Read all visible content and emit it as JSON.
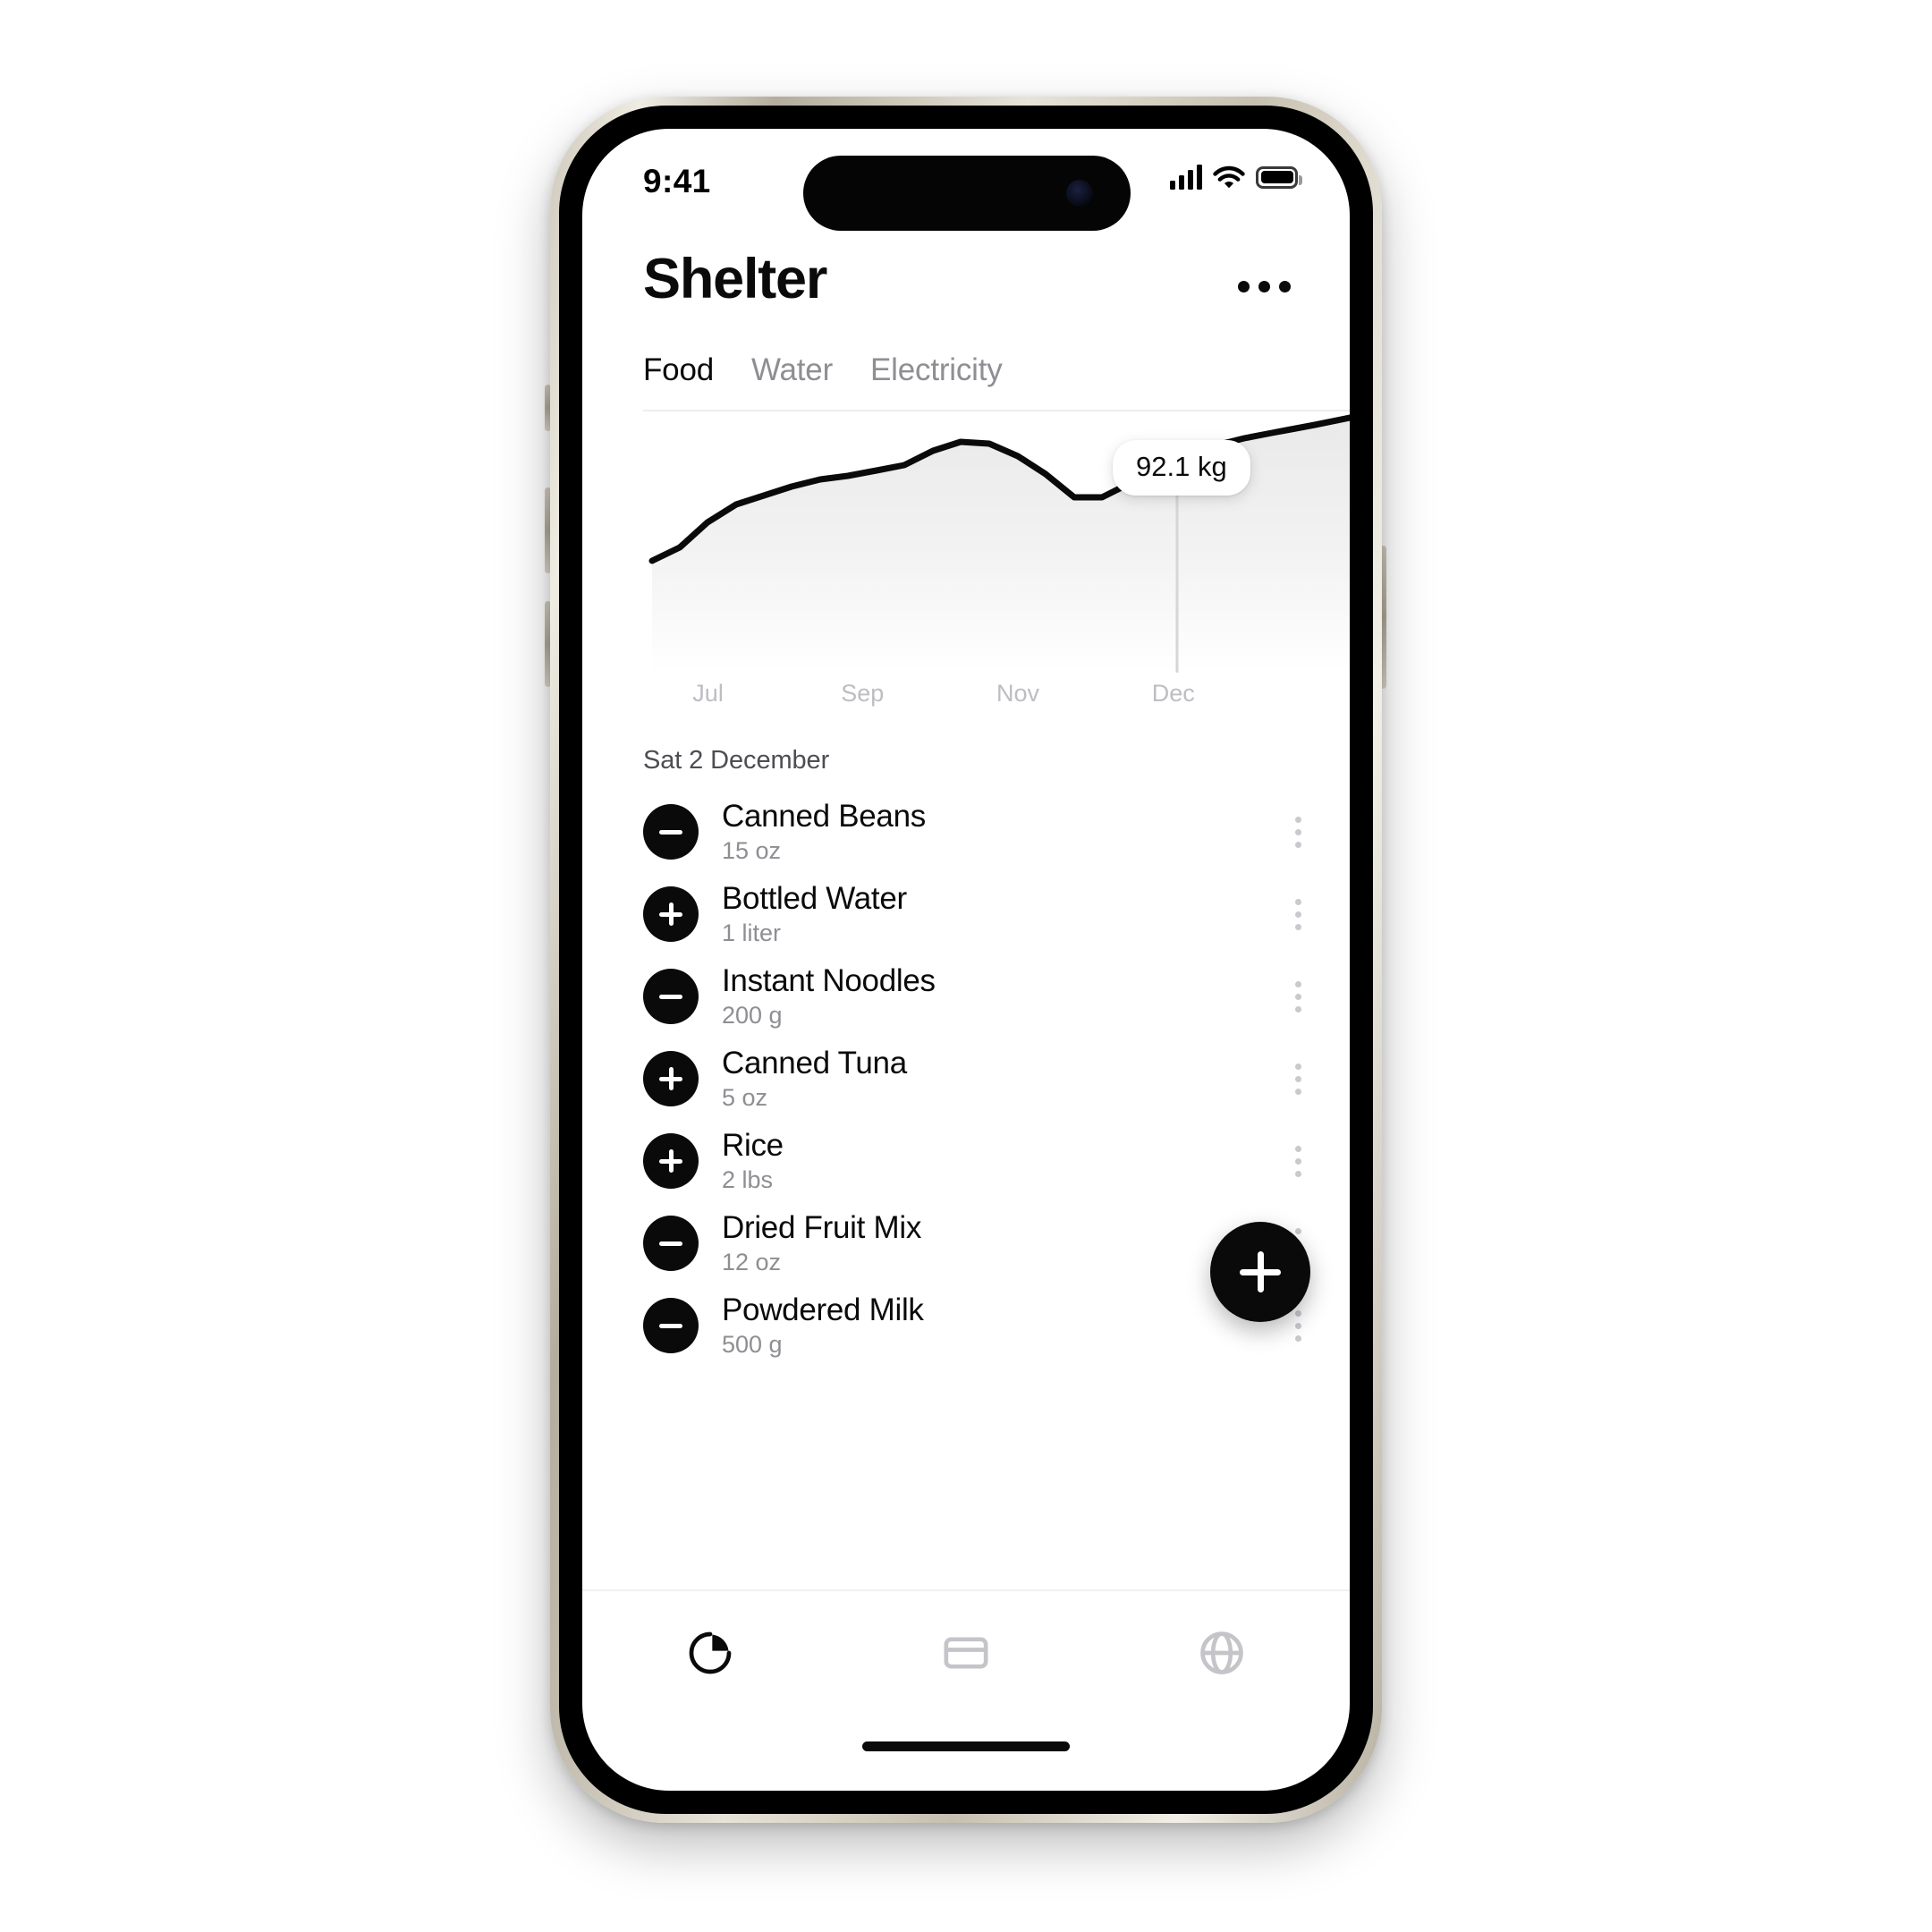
{
  "status_bar": {
    "time": "9:41",
    "signal_icon": "cellular-bars-icon",
    "wifi_icon": "wifi-icon",
    "battery_icon": "battery-full-icon"
  },
  "header": {
    "title": "Shelter",
    "more_icon": "more-horizontal-icon"
  },
  "tabs": [
    {
      "label": "Food",
      "active": true
    },
    {
      "label": "Water",
      "active": false
    },
    {
      "label": "Electricity",
      "active": false
    }
  ],
  "chart_data": {
    "type": "area",
    "title": "",
    "xlabel": "",
    "ylabel": "",
    "unit": "kg",
    "tick_labels": [
      "Jul",
      "Sep",
      "Nov",
      "Dec"
    ],
    "tick_positions_pct": [
      7,
      28,
      50,
      72
    ],
    "highlight": {
      "label": "92.1 kg",
      "value": 92.1,
      "x_pct": 57.5
    },
    "grid": false,
    "legend": false,
    "x": [
      0,
      4,
      8,
      12,
      16,
      20,
      24,
      28,
      32,
      36,
      40,
      44,
      48,
      52,
      56,
      60,
      64,
      68,
      72,
      76,
      80,
      84,
      88,
      92,
      96,
      100
    ],
    "values": [
      56.0,
      59.5,
      66.5,
      71.5,
      74.0,
      76.5,
      78.5,
      79.5,
      81.0,
      82.5,
      86.5,
      89.0,
      88.5,
      85.0,
      80.0,
      73.5,
      73.5,
      77.5,
      82.5,
      85.5,
      88.0,
      90.0,
      91.5,
      92.1,
      93.5,
      95.5
    ],
    "ylim": [
      50,
      100
    ]
  },
  "section": {
    "date_header": "Sat 2 December"
  },
  "items": [
    {
      "name": "Canned Beans",
      "qty": "15 oz",
      "action": "minus",
      "menu_icon": "kebab-menu-icon"
    },
    {
      "name": "Bottled Water",
      "qty": "1 liter",
      "action": "plus",
      "menu_icon": "kebab-menu-icon"
    },
    {
      "name": "Instant Noodles",
      "qty": "200 g",
      "action": "minus",
      "menu_icon": "kebab-menu-icon"
    },
    {
      "name": "Canned Tuna",
      "qty": "5 oz",
      "action": "plus",
      "menu_icon": "kebab-menu-icon"
    },
    {
      "name": "Rice",
      "qty": "2 lbs",
      "action": "plus",
      "menu_icon": "kebab-menu-icon"
    },
    {
      "name": "Dried Fruit Mix",
      "qty": "12 oz",
      "action": "minus",
      "menu_icon": "kebab-menu-icon"
    },
    {
      "name": "Powdered Milk",
      "qty": "500 g",
      "action": "minus",
      "menu_icon": "kebab-menu-icon"
    }
  ],
  "fab": {
    "icon": "plus-icon"
  },
  "bottom_nav": [
    {
      "icon": "pie-chart-icon",
      "active": true
    },
    {
      "icon": "card-icon",
      "active": false
    },
    {
      "icon": "globe-icon",
      "active": false
    }
  ],
  "colors": {
    "accent": "#0a0a0a",
    "muted": "#8e8e93",
    "axis_label": "#bdbdc2",
    "divider": "#ededed",
    "chart_fill_top": "#ececec",
    "background": "#ffffff"
  }
}
